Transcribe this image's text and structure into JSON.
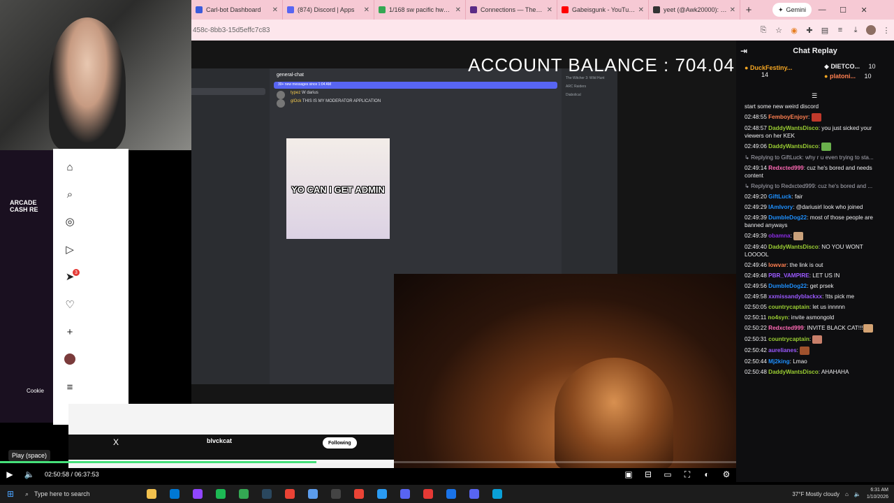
{
  "browser": {
    "tabs": [
      {
        "title": "Carl-bot Dashboard",
        "color": "#3b5bdb"
      },
      {
        "title": "(874) Discord | Apps",
        "color": "#5865f2"
      },
      {
        "title": "1/168 sw pacific hwy - G",
        "color": "#34a853"
      },
      {
        "title": "Connections — The Ne",
        "color": "#5b2b86"
      },
      {
        "title": "Gabeisgunk - YouTube",
        "color": "#ff0000"
      },
      {
        "title": "yeet (@Awk20000): \"Ne",
        "color": "#333333"
      }
    ],
    "new_tab": "+",
    "gemini_label": "Gemini",
    "url": "458c-8bb3-15d5effc7c83"
  },
  "video": {
    "balance_text": "ACCOUNT BALANCE : 704.04",
    "play_tooltip": "Play (space)",
    "time_current": "02:50:58",
    "time_total": "06:37:53",
    "progress_fraction": 0.43
  },
  "discord": {
    "channel": "general-chat",
    "new_messages": "30+ new messages since 1:04 AM",
    "mark_read": "Mark As Read",
    "meme_text": "YO CAN I GET ADMIN",
    "channels": [
      "suggestions",
      "announcements",
      "general-chat",
      "general-politics",
      "general-drama",
      "general-1",
      "general-2",
      "general-3"
    ],
    "messages": [
      {
        "author": "typez",
        "text": "W darius"
      },
      {
        "author": "glOck",
        "text": "THIS IS MY MODERATOR APPLICATION"
      }
    ],
    "members": [
      "The Witcher 3: Wild Hunt",
      "ARC Raiders",
      "Diabolical"
    ]
  },
  "left_panel": {
    "arcade_text": "ARCADE CASH RE",
    "cookie_text": "Cookie",
    "notif_count": "3"
  },
  "twitter": {
    "name": "blvckcat",
    "following": "Following",
    "x_icon": "X"
  },
  "chat": {
    "title": "Chat Replay",
    "gifters": [
      {
        "name": "DuckFestiny...",
        "count": "14"
      },
      {
        "name": "DIETCO...",
        "count": "10"
      },
      {
        "name": "platoni...",
        "count": "10"
      }
    ],
    "lines": [
      {
        "ts": "",
        "user": "",
        "user_color": "#efeff1",
        "text": "start some new weird discord",
        "reply": ""
      },
      {
        "ts": "02:48:55",
        "user": "FemboyEnjoyr",
        "user_color": "#ff7f50",
        "text": "",
        "reply": "",
        "emote": "#c0392b"
      },
      {
        "ts": "02:48:57",
        "user": "DaddyWantsDisco",
        "user_color": "#9acd32",
        "text": "you just sicked your viewers on her KEK",
        "reply": ""
      },
      {
        "ts": "02:49:06",
        "user": "DaddyWantsDisco",
        "user_color": "#9acd32",
        "text": "",
        "reply": "",
        "emote": "#6ab04c"
      },
      {
        "ts": "",
        "user": "",
        "user_color": "#efeff1",
        "text": "",
        "reply": "Replying to GiftLuck: why r u even trying to sta..."
      },
      {
        "ts": "02:49:14",
        "user": "Redxcted999",
        "user_color": "#ff69b4",
        "text": "cuz he's bored and needs content",
        "reply": ""
      },
      {
        "ts": "",
        "user": "",
        "user_color": "#efeff1",
        "text": "",
        "reply": "Replying to Redxcted999: cuz he's bored and ..."
      },
      {
        "ts": "02:49:20",
        "user": "GiftLuck",
        "user_color": "#1e90ff",
        "text": "fair",
        "reply": ""
      },
      {
        "ts": "02:49:29",
        "user": "IAmIvory",
        "user_color": "#1e90ff",
        "text": "@dariusirl look who joined",
        "reply": ""
      },
      {
        "ts": "02:49:39",
        "user": "DumbleDog22",
        "user_color": "#1e90ff",
        "text": "most of those people are banned anyways",
        "reply": ""
      },
      {
        "ts": "02:49:39",
        "user": "obamna",
        "user_color": "#8a2be2",
        "text": "",
        "reply": "",
        "emote": "#c8a07a"
      },
      {
        "ts": "02:49:40",
        "user": "DaddyWantsDisco",
        "user_color": "#9acd32",
        "text": "NO YOU WONT LOOOOL",
        "reply": ""
      },
      {
        "ts": "02:49:46",
        "user": "lowvar",
        "user_color": "#ff7f50",
        "text": "the link is out",
        "reply": ""
      },
      {
        "ts": "02:49:48",
        "user": "PBR_VAMPIRE",
        "user_color": "#9b59ff",
        "text": "LET US IN",
        "reply": ""
      },
      {
        "ts": "02:49:56",
        "user": "DumbleDog22",
        "user_color": "#1e90ff",
        "text": "get prsek",
        "reply": ""
      },
      {
        "ts": "02:49:58",
        "user": "xxmissandyblackxx",
        "user_color": "#9b59ff",
        "text": "!tts pick me",
        "reply": ""
      },
      {
        "ts": "02:50:05",
        "user": "countrycaptain",
        "user_color": "#9acd32",
        "text": "let us innnnn",
        "reply": ""
      },
      {
        "ts": "02:50:11",
        "user": "no4syn",
        "user_color": "#9acd32",
        "text": "invite asmongold",
        "reply": ""
      },
      {
        "ts": "02:50:22",
        "user": "Redxcted999",
        "user_color": "#ff69b4",
        "text": "INVITE BLACK CAT!!!",
        "reply": "",
        "emote": "#d4a373"
      },
      {
        "ts": "02:50:31",
        "user": "countrycaptain",
        "user_color": "#9acd32",
        "text": "",
        "reply": "",
        "emote": "#c87f6a"
      },
      {
        "ts": "02:50:42",
        "user": "aurelianes",
        "user_color": "#9b59ff",
        "text": "",
        "reply": "",
        "emote": "#a0522d"
      },
      {
        "ts": "02:50:44",
        "user": "Mj2king",
        "user_color": "#1e90ff",
        "text": "Lmao",
        "reply": ""
      },
      {
        "ts": "02:50:48",
        "user": "DaddyWantsDisco",
        "user_color": "#9acd32",
        "text": "AHAHAHA",
        "reply": ""
      }
    ]
  },
  "taskbar": {
    "search_placeholder": "Type here to search",
    "weather": "37°F  Mostly cloudy",
    "time": "6:31 AM",
    "date": "1/10/2026",
    "apps": [
      "#f2c14e",
      "#0078d4",
      "#9146ff",
      "#1db954",
      "#34a853",
      "#2a475e",
      "#ea4335",
      "#5c9ded",
      "#444444",
      "#ea4335",
      "#2a9bf3",
      "#5865f2",
      "#e53935",
      "#1a73e8",
      "#5865f2",
      "#0aa0d8"
    ]
  }
}
